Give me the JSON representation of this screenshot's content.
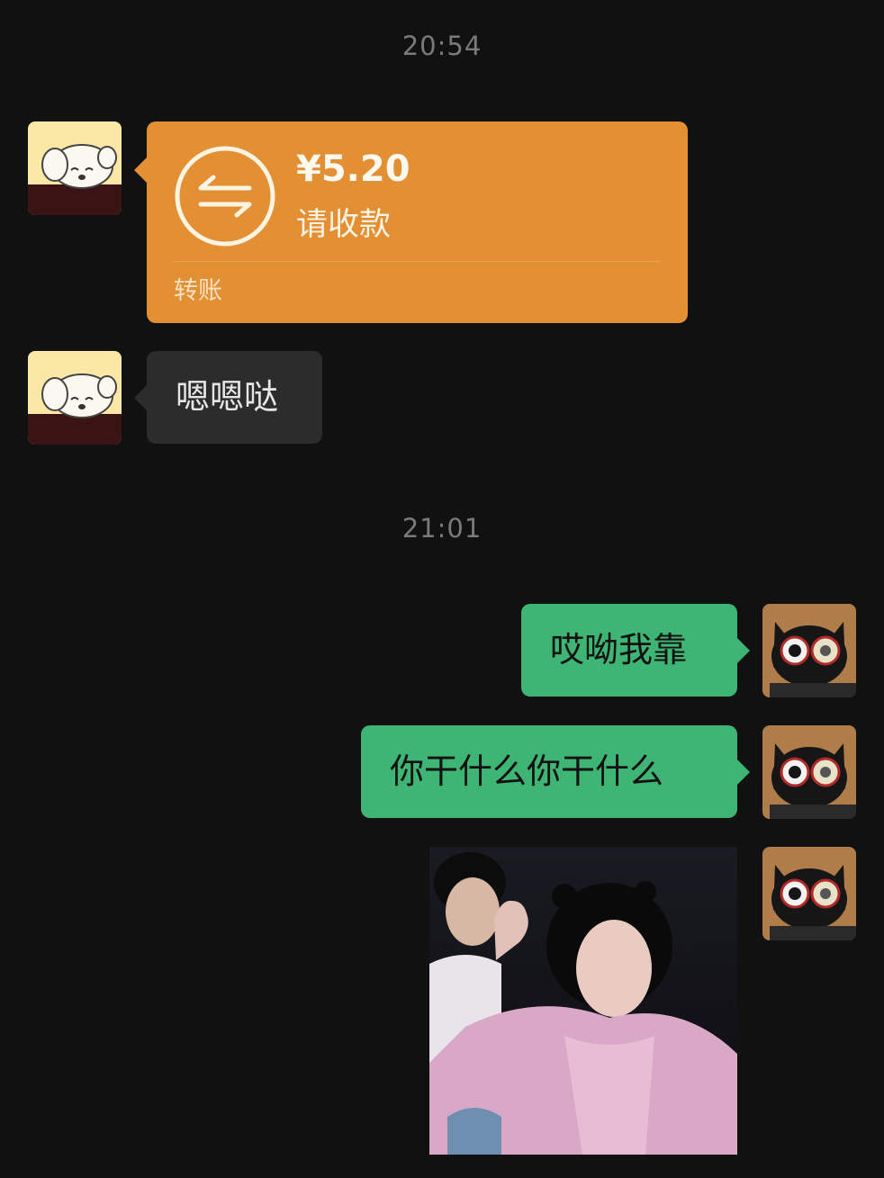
{
  "timestamps": [
    "20:54",
    "21:01"
  ],
  "transfer": {
    "amount": "¥5.20",
    "status": "请收款",
    "type_label": "转账",
    "icon": "transfer-arrows-icon",
    "color": "#e38f34"
  },
  "incoming_messages": [
    {
      "text": "嗯嗯哒"
    }
  ],
  "outgoing_messages": [
    {
      "text": "哎呦我靠"
    },
    {
      "text": "你干什么你干什么"
    }
  ],
  "colors": {
    "background": "#111111",
    "incoming_bubble": "#2c2c2c",
    "outgoing_bubble": "#3eb575",
    "timestamp": "#7a7a7a"
  }
}
